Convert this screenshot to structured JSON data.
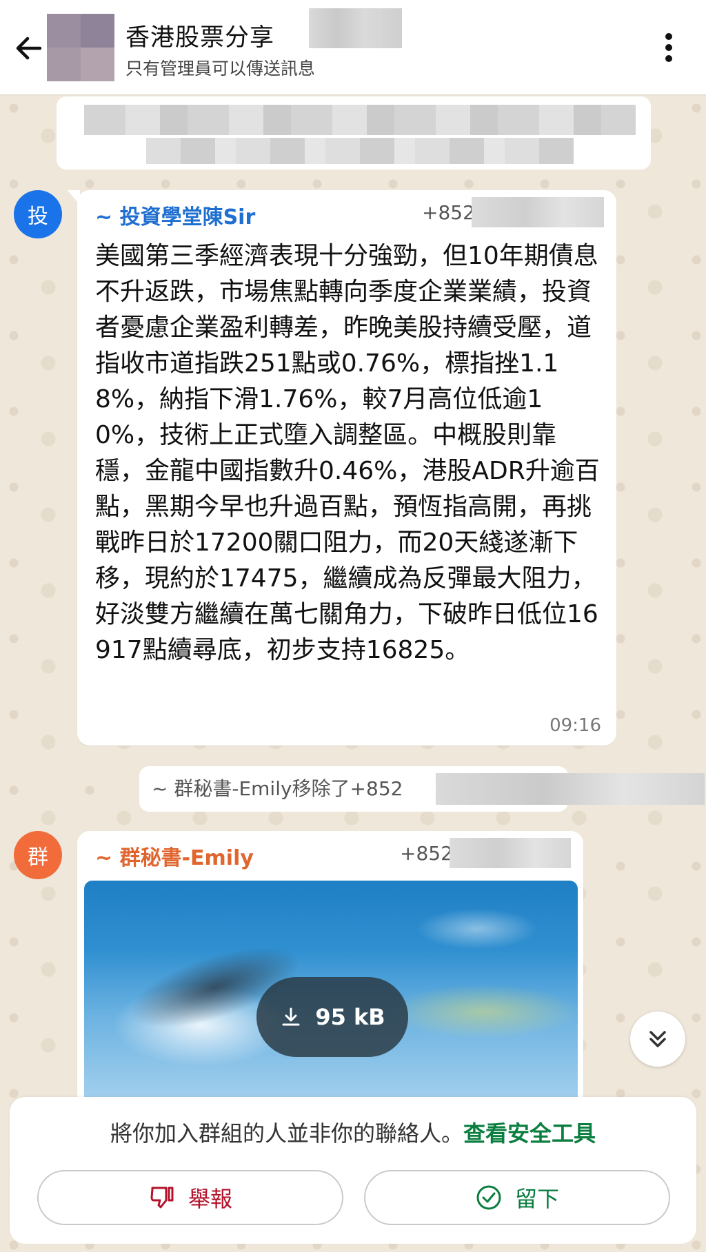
{
  "header": {
    "group_title": "香港股票分享",
    "subtitle": "只有管理員可以傳送訊息"
  },
  "messages": [
    {
      "avatar_char": "投",
      "avatar_color": "#1a73e8",
      "sender": "~ 投資學堂陳Sir",
      "sender_color": "#1f6fd1",
      "phone": "+852",
      "text": "美國第三季經濟表現十分強勁，但10年期債息不升返跌，市場焦點轉向季度企業業績，投資者憂慮企業盈利轉差，昨晚美股持續受壓，道指收市道指跌251點或0.76%，標指挫1.18%，納指下滑1.76%，較7月高位低逾10%，技術上正式墮入調整區。中概股則靠穩，金龍中國指數升0.46%，港股ADR升逾百點，黑期今早也升過百點，預恆指高開，再挑戰昨日於17200關口阻力，而20天綫遂漸下移，現約於17475，繼續成為反彈最大阻力，好淡雙方繼續在萬七關角力，下破昨日低位16917點續尋底，初步支持16825。",
      "time": "09:16"
    },
    {
      "avatar_char": "群",
      "avatar_color": "#f26b3a",
      "sender": "~ 群秘書-Emily",
      "sender_color": "#e0662f",
      "phone": "+852",
      "attachment_size": "95 kB"
    }
  ],
  "system_notice": {
    "text": "~ 群秘書-Emily移除了+852"
  },
  "safety": {
    "text": "將你加入群組的人並非你的聯絡人。",
    "link": "查看安全工具",
    "report_label": "舉報",
    "stay_label": "留下"
  }
}
